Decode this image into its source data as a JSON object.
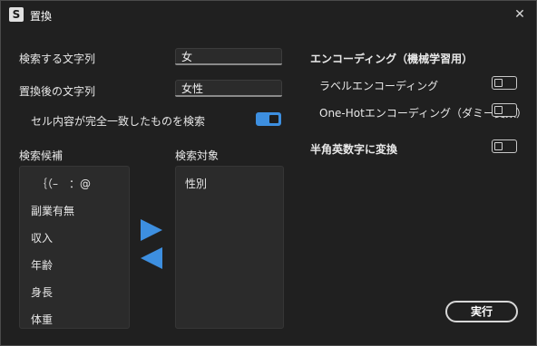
{
  "window": {
    "app_icon": "S",
    "title": "置換",
    "close_icon": "✕"
  },
  "search": {
    "label": "検索する文字列",
    "value": "女"
  },
  "replace": {
    "label": "置換後の文字列",
    "value": "女性"
  },
  "match_whole": {
    "label": "セル内容が完全一致したものを検索",
    "checked": true
  },
  "candidates": {
    "label": "検索候補",
    "items": [
      "｛（–　：@",
      "副業有無",
      "収入",
      "年齢",
      "身長",
      "体重"
    ]
  },
  "targets": {
    "label": "検索対象",
    "items": [
      "性別"
    ]
  },
  "encoding": {
    "heading": "エンコーディング（機械学習用）",
    "label_encoding": {
      "label": "ラベルエンコーディング",
      "checked": false
    },
    "onehot": {
      "label": "One-Hotエンコーディング（ダミー変数）",
      "checked": false
    }
  },
  "halfwidth": {
    "label": "半角英数字に変換",
    "checked": false
  },
  "execute_label": "実行",
  "accent_color": "#3d8fe0",
  "icons": {
    "add": "arrow-right-icon",
    "remove": "arrow-left-icon"
  }
}
